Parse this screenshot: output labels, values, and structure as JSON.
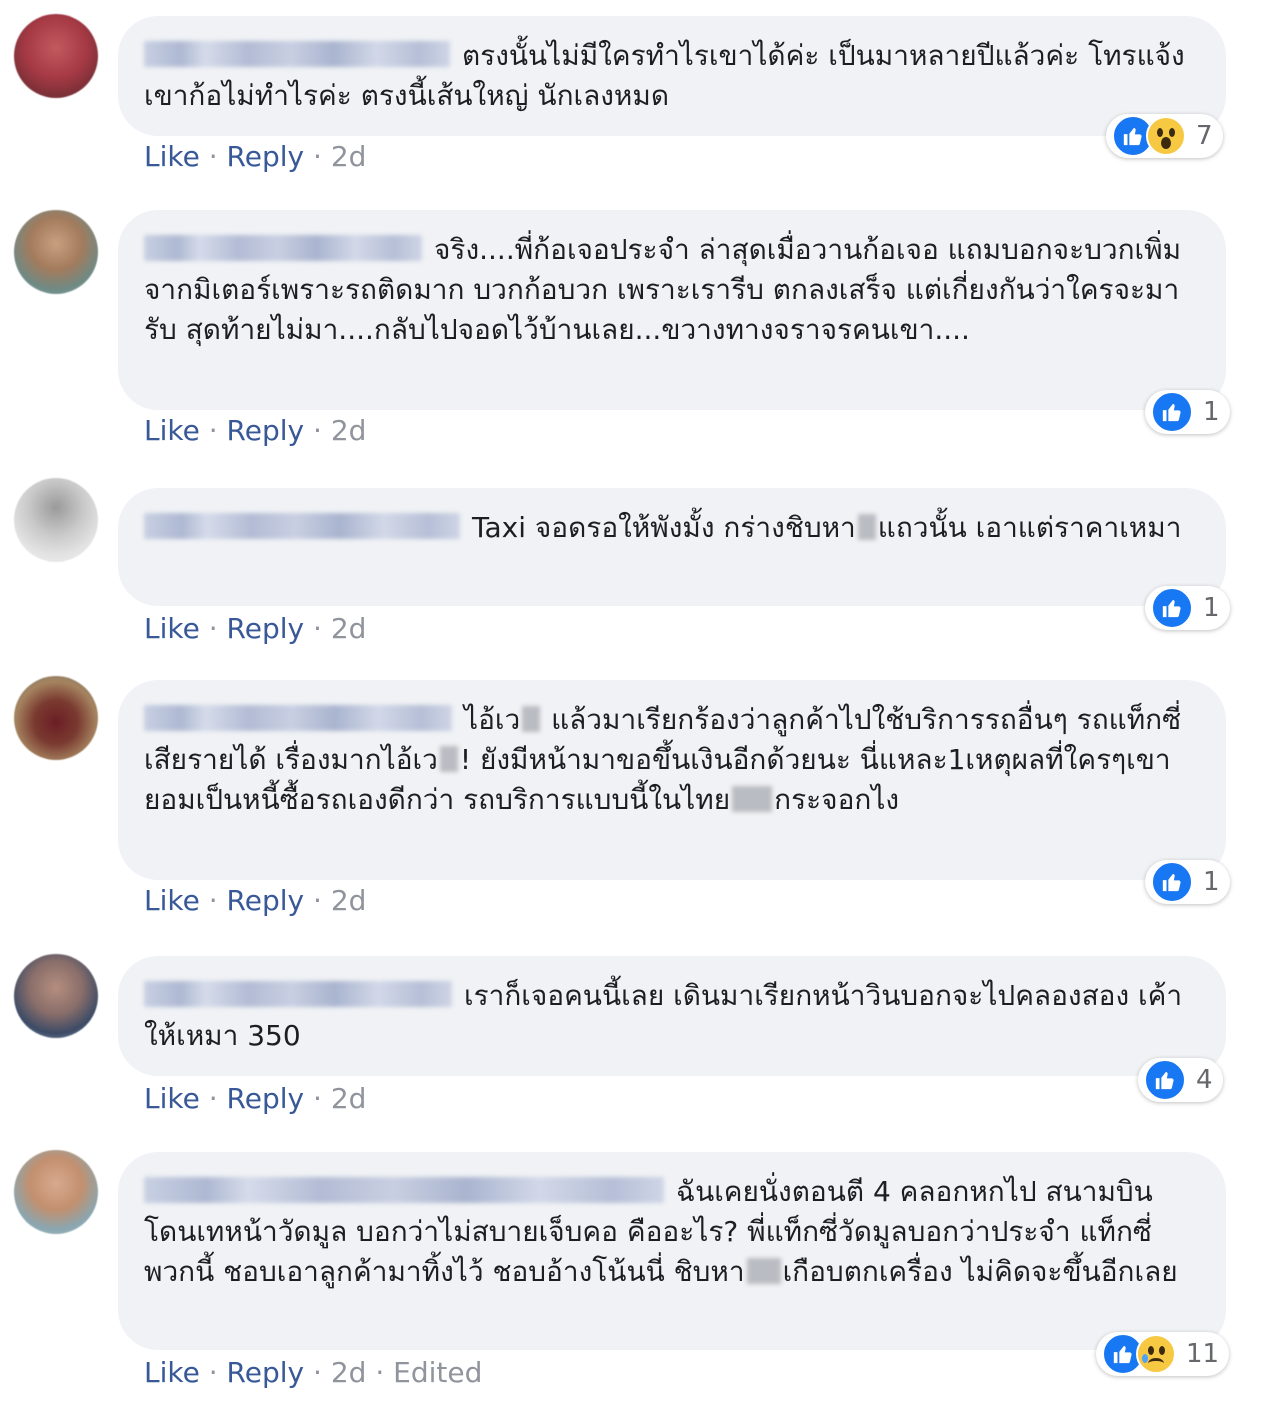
{
  "comments": [
    {
      "text": "ตรงนั้นไม่มีใครทำไรเขาได้ค่ะ เป็นมาหลายปีแล้วค่ะ โทรแจ้งเขาก้อไม่ทำไรค่ะ ตรงนี้เส้นใหญ่ นักเลงหมด",
      "like_label": "Like",
      "reply_label": "Reply",
      "time": "2d",
      "reactions": [
        "like-icon",
        "wow-icon"
      ],
      "reaction_count": "7"
    },
    {
      "text": "จริง....พี่ก้อเจอประจำ ล่าสุดเมื่อวานก้อเจอ แถมบอกจะบวกเพิ่มจากมิเตอร์เพราะรถติดมาก บวกก้อบวก เพราะเรารีบ ตกลงเสร็จ แต่เกี่ยงกันว่าใครจะมารับ สุดท้ายไม่มา....กลับไปจอดไว้บ้านเลย...ขวางทางจราจรคนเขา....",
      "like_label": "Like",
      "reply_label": "Reply",
      "time": "2d",
      "reactions": [
        "like-icon"
      ],
      "reaction_count": "1"
    },
    {
      "text_a": "Taxi จอดรอให้พังมั้ง กร่างชิบหา",
      "text_b": "แถวนั้น เอาแต่ราคาเหมา",
      "like_label": "Like",
      "reply_label": "Reply",
      "time": "2d",
      "reactions": [
        "like-icon"
      ],
      "reaction_count": "1"
    },
    {
      "text_a": "ไอ้เว",
      "text_b": " แล้วมาเรียกร้องว่าลูกค้าไปใช้บริการรถอื่นๆ รถแท็กซี่เสียรายได้ เรื่องมากไอ้เว",
      "text_c": "! ยังมีหน้ามาขอขึ้นเงินอีกด้วยนะ นี่แหละ1เหตุผลที่ใครๆเขายอมเป็นหนี้ซื้อรถเองดีกว่า รถบริการแบบนี้ในไทย",
      "text_d": "กระจอกไง",
      "like_label": "Like",
      "reply_label": "Reply",
      "time": "2d",
      "reactions": [
        "like-icon"
      ],
      "reaction_count": "1"
    },
    {
      "text": "เราก็เจอคนนี้เลย เดินมาเรียกหน้าวินบอกจะไปคลองสอง เค้าให้เหมา 350",
      "like_label": "Like",
      "reply_label": "Reply",
      "time": "2d",
      "reactions": [
        "like-icon"
      ],
      "reaction_count": "4"
    },
    {
      "text_a": "ฉันเคยนั่งตอนตี 4 คลอกหกไป สนามบิน โดนเทหน้าวัดมูล บอกว่าไม่สบายเจ็บคอ คืออะไร? พี่แท็กซี่วัดมูลบอกว่าประจำ แท็กซี่พวกนี้ ชอบเอาลูกค้ามาทิ้งไว้ ชอบอ้างโน้นนี่ ชิบหา",
      "text_b": "เกือบตกเครื่อง ไม่คิดจะขึ้นอีกเลย",
      "like_label": "Like",
      "reply_label": "Reply",
      "time": "2d",
      "edited": "Edited",
      "reactions": [
        "like-icon",
        "sad-icon"
      ],
      "reaction_count": "11"
    }
  ],
  "separator": "·"
}
